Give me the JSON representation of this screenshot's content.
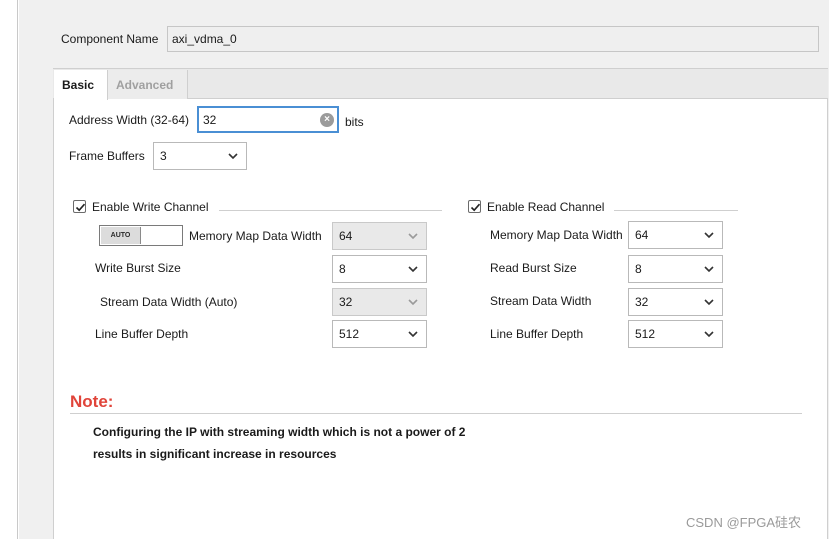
{
  "component": {
    "label": "Component Name",
    "value": "axi_vdma_0"
  },
  "tabs": [
    {
      "label": "Basic",
      "active": true
    },
    {
      "label": "Advanced",
      "active": false
    }
  ],
  "address_width": {
    "label": "Address Width (32-64)",
    "value": "32",
    "unit": "bits"
  },
  "frame_buffers": {
    "label": "Frame Buffers",
    "value": "3"
  },
  "write_channel": {
    "enable_label": "Enable Write Channel",
    "checked": true,
    "auto_toggle": "AUTO",
    "memory_map_label": "Memory Map Data Width",
    "memory_map_value": "64",
    "burst_label": "Write Burst Size",
    "burst_value": "8",
    "stream_label": "Stream Data Width (Auto)",
    "stream_value": "32",
    "line_buffer_label": "Line Buffer Depth",
    "line_buffer_value": "512"
  },
  "read_channel": {
    "enable_label": "Enable Read Channel",
    "checked": true,
    "memory_map_label": "Memory Map Data Width",
    "memory_map_value": "64",
    "burst_label": "Read Burst Size",
    "burst_value": "8",
    "stream_label": "Stream Data Width",
    "stream_value": "32",
    "line_buffer_label": "Line Buffer Depth",
    "line_buffer_value": "512"
  },
  "note": {
    "title": "Note:",
    "line1": "Configuring the IP with streaming width which is not a power of 2",
    "line2": "results in significant increase in resources"
  },
  "watermark": "CSDN @FPGA硅农",
  "colors": {
    "accent_focus": "#4a8fd4",
    "note_red": "#e0443a"
  }
}
